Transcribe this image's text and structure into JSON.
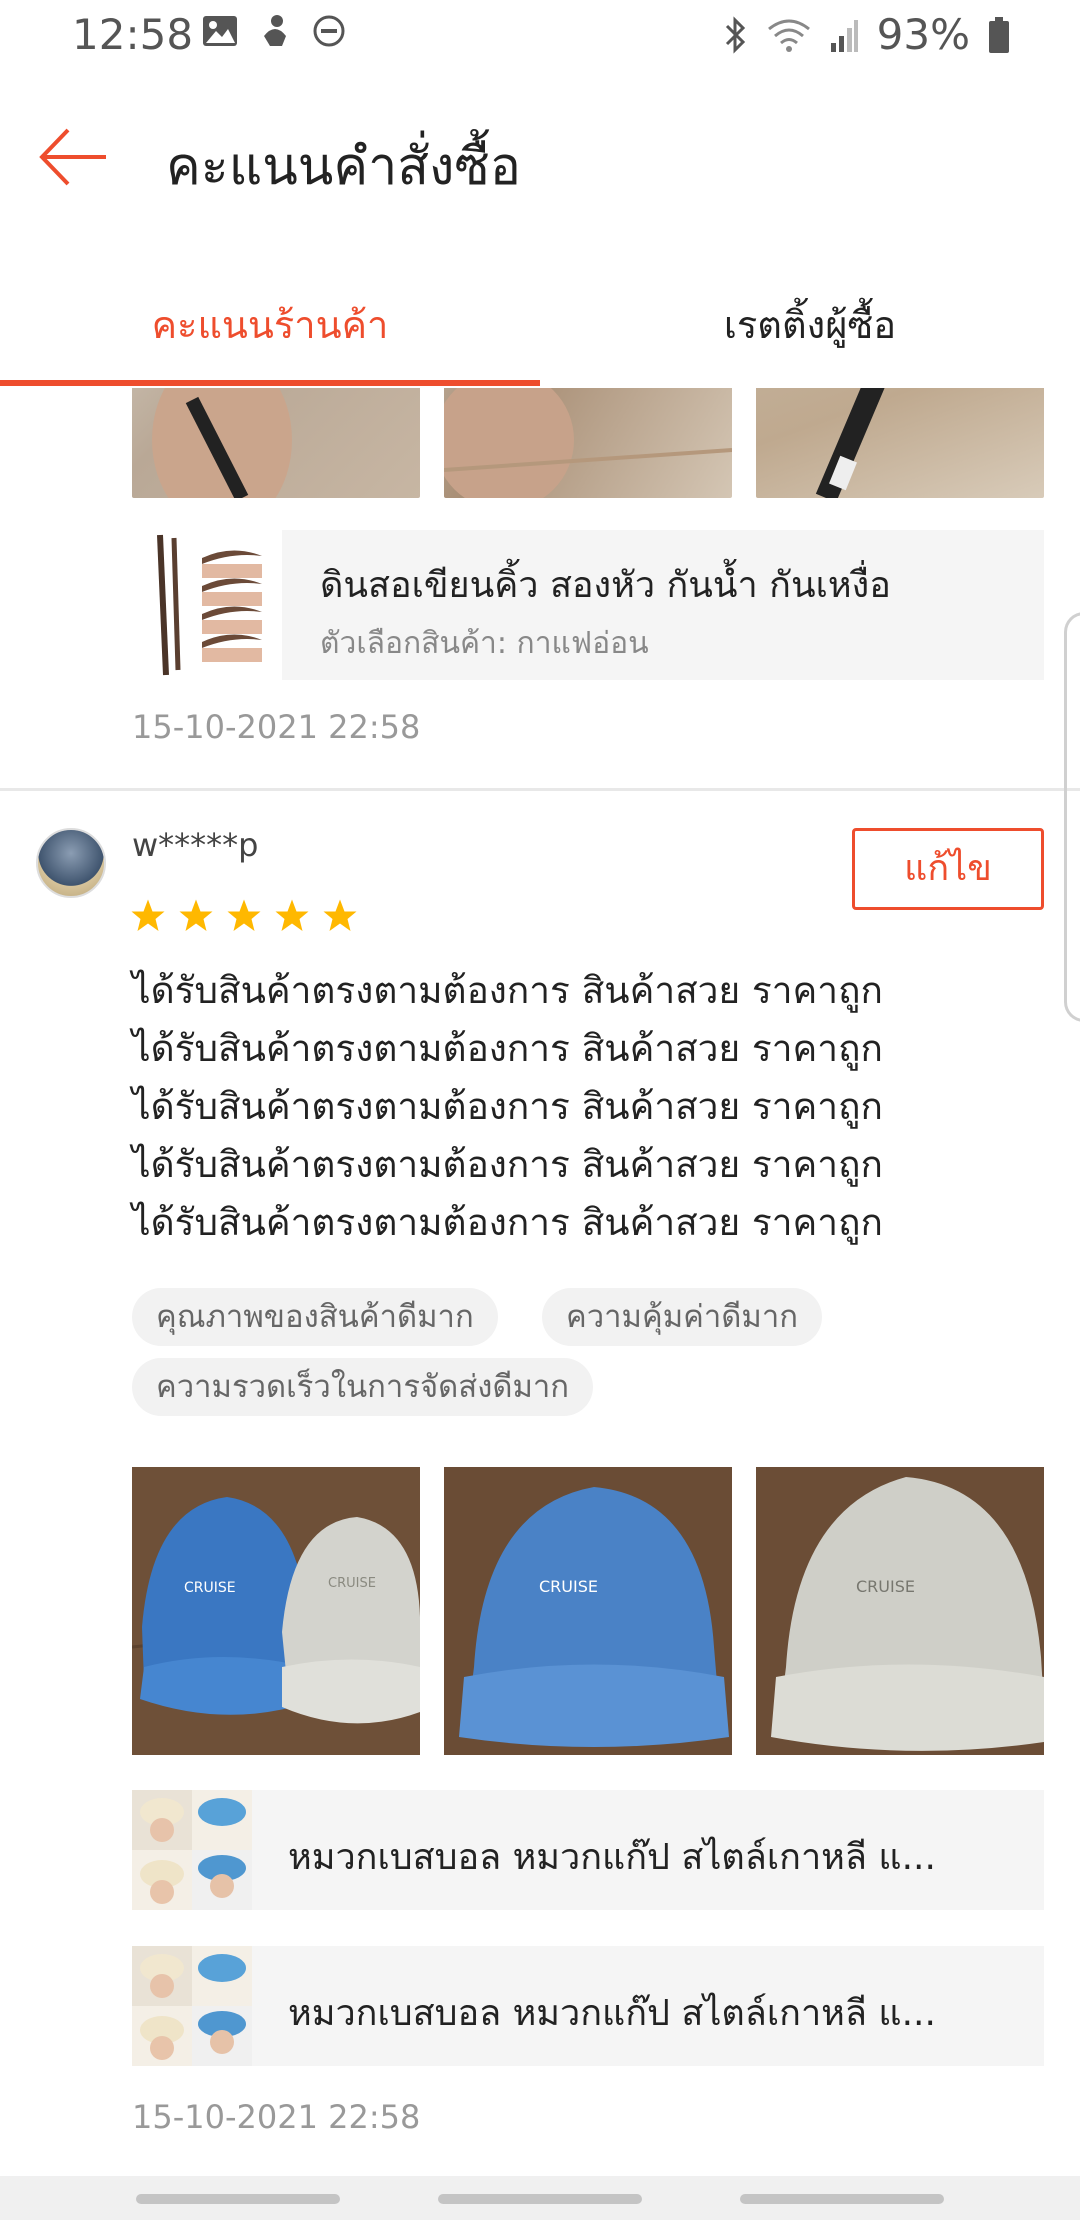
{
  "status_bar": {
    "time": "12:58",
    "battery": "93%",
    "left_icons": [
      "image-icon",
      "person-icon",
      "do-not-disturb-icon"
    ],
    "right_icons": [
      "bluetooth-icon",
      "wifi-icon",
      "signal-icon",
      "battery-icon"
    ]
  },
  "app_bar": {
    "title": "คะแนนคำสั่งซื้อ",
    "accent_color": "#ee4d2d"
  },
  "tabs": [
    {
      "label": "คะแนนร้านค้า",
      "active": true
    },
    {
      "label": "เรตติ้งผู้ซื้อ",
      "active": false
    }
  ],
  "previous_review": {
    "product": {
      "name": "ดินสอเขียนคิ้ว สองหัว กันน้ำ กันเหงื่อ",
      "variant": "ตัวเลือกสินค้า: กาแฟอ่อน"
    },
    "timestamp": "15-10-2021 22:58"
  },
  "review": {
    "username": "w*****p",
    "edit_label": "แก้ไข",
    "rating": 5,
    "text_lines": [
      "ได้รับสินค้าตรงตามต้องการ สินค้าสวย ราคาถูก",
      "ได้รับสินค้าตรงตามต้องการ สินค้าสวย ราคาถูก",
      "ได้รับสินค้าตรงตามต้องการ สินค้าสวย ราคาถูก",
      "ได้รับสินค้าตรงตามต้องการ สินค้าสวย ราคาถูก",
      "ได้รับสินค้าตรงตามต้องการ สินค้าสวย ราคาถูก"
    ],
    "tags": [
      "คุณภาพของสินค้าดีมาก",
      "ความคุ้มค่าดีมาก",
      "ความรวดเร็วในการจัดส่งดีมาก"
    ],
    "photo_text": "CRUISE",
    "products": [
      {
        "name": "หมวกเบสบอล หมวกแก๊ป สไตล์เกาหลี แ..."
      },
      {
        "name": "หมวกเบสบอล หมวกแก๊ป สไตล์เกาหลี แ..."
      }
    ],
    "timestamp": "15-10-2021 22:58"
  }
}
